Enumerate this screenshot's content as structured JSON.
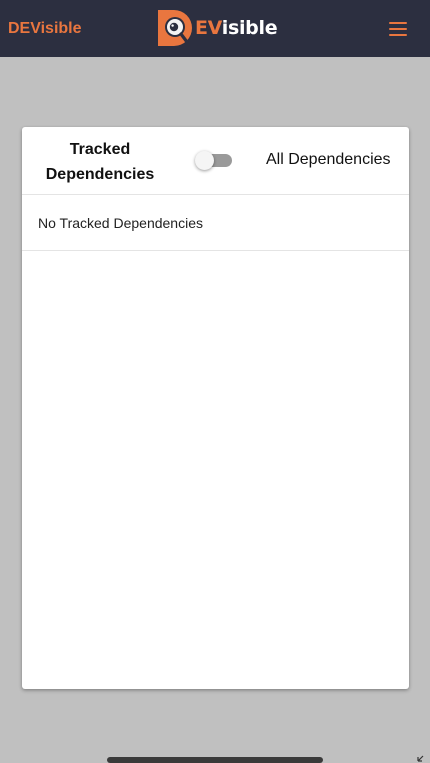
{
  "navbar": {
    "brand": "DEVisible",
    "logo": {
      "d": "D",
      "ev": "EV",
      "rest": "isible"
    },
    "menu_icon": "hamburger-menu-icon"
  },
  "card": {
    "toggle_left_label": "Tracked Dependencies",
    "toggle_right_label": "All Dependencies",
    "toggle_on": false,
    "empty_message": "No Tracked Dependencies"
  },
  "colors": {
    "navbar_bg": "#2c2f40",
    "accent": "#e9763f",
    "page_bg": "#c0c0c0",
    "card_bg": "#ffffff"
  }
}
